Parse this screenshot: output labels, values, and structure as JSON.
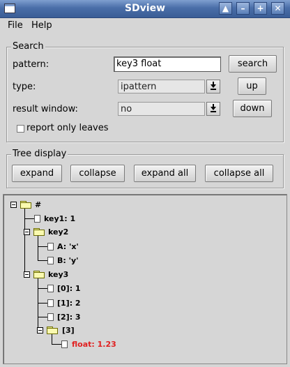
{
  "window": {
    "title": "SDview"
  },
  "title_buttons": {
    "up": "▲",
    "minimize": "–",
    "maximize": "+",
    "close": "✕"
  },
  "menu": {
    "file": "File",
    "help": "Help"
  },
  "search": {
    "legend": "Search",
    "pattern_label": "pattern:",
    "pattern_value": "key3 float",
    "search_button": "search",
    "type_label": "type:",
    "type_value": "ipattern",
    "up_button": "up",
    "result_window_label": "result window:",
    "result_window_value": "no",
    "down_button": "down",
    "report_only_leaves_label": "report only leaves",
    "report_only_leaves_checked": false
  },
  "tree_display": {
    "legend": "Tree display",
    "expand": "expand",
    "collapse": "collapse",
    "expand_all": "expand all",
    "collapse_all": "collapse all"
  },
  "tree": {
    "root": "#",
    "key1": "key1: 1",
    "key2": "key2",
    "key2_a": "A: 'x'",
    "key2_b": "B: 'y'",
    "key3": "key3",
    "key3_0": "[0]: 1",
    "key3_1": "[1]: 2",
    "key3_2": "[2]: 3",
    "key3_3": "[3]",
    "key3_3_float": "float: 1.23",
    "highlight_color": "#e02020",
    "folder_color": "#fafab0"
  }
}
